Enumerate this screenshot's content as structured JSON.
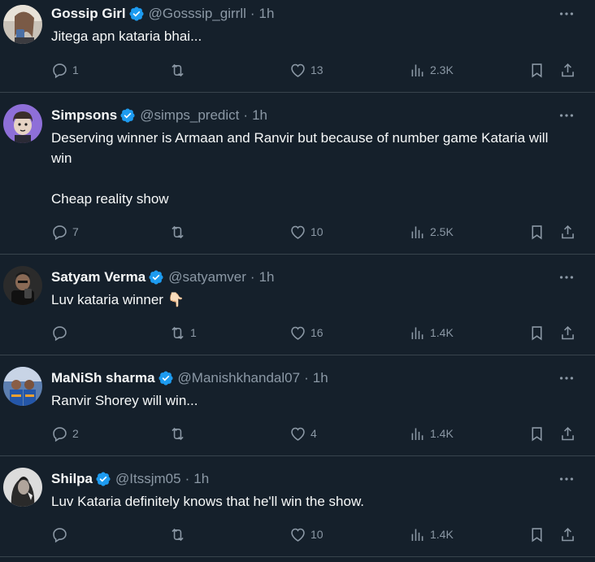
{
  "tweets": [
    {
      "name": "Gossip Girl",
      "handle": "@Gosssip_girrll",
      "time": "1h",
      "text": [
        "Jitega apn kataria bhai..."
      ],
      "replies": "1",
      "retweets": "",
      "likes": "13",
      "views": "2.3K"
    },
    {
      "name": "Simpsons",
      "handle": "@simps_predict",
      "time": "1h",
      "text": [
        "Deserving winner is Armaan and Ranvir but because of number game Kataria will win",
        "",
        "Cheap reality show"
      ],
      "replies": "7",
      "retweets": "",
      "likes": "10",
      "views": "2.5K"
    },
    {
      "name": "Satyam Verma",
      "handle": "@satyamver",
      "time": "1h",
      "text": [
        "Luv kataria winner 👇🏻"
      ],
      "replies": "",
      "retweets": "1",
      "likes": "16",
      "views": "1.4K"
    },
    {
      "name": "MaNiSh sharma",
      "handle": "@Manishkhandal07",
      "time": "1h",
      "text": [
        "Ranvir Shorey will win..."
      ],
      "replies": "2",
      "retweets": "",
      "likes": "4",
      "views": "1.4K"
    },
    {
      "name": "Shilpa",
      "handle": "@Itssjm05",
      "time": "1h",
      "text": [
        "Luv Kataria definitely knows that he'll win the show."
      ],
      "replies": "",
      "retweets": "",
      "likes": "10",
      "views": "1.4K"
    }
  ],
  "separator": "·",
  "colors": {
    "background": "#15202b",
    "text": "#f7f9f9",
    "muted": "#8b98a5",
    "verified": "#1d9bf0",
    "divider": "#38444d"
  },
  "icons": [
    "verified-badge-icon",
    "more-icon",
    "reply-icon",
    "retweet-icon",
    "like-icon",
    "views-icon",
    "bookmark-icon",
    "share-icon"
  ]
}
